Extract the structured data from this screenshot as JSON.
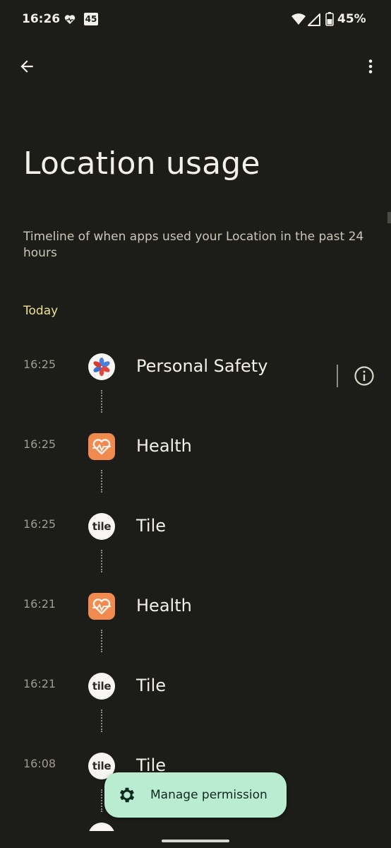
{
  "status_bar": {
    "time": "16:26",
    "badge": "45",
    "battery": "45%"
  },
  "header": {
    "title": "Location usage",
    "description": "Timeline of when apps used your Location in the past 24 hours"
  },
  "section": {
    "label": "Today"
  },
  "timeline": [
    {
      "time": "16:25",
      "app": "Personal Safety",
      "icon": "personal-safety-icon"
    },
    {
      "time": "16:25",
      "app": "Health",
      "icon": "health-icon"
    },
    {
      "time": "16:25",
      "app": "Tile",
      "icon": "tile-icon",
      "icon_text": "tile"
    },
    {
      "time": "16:21",
      "app": "Health",
      "icon": "health-icon"
    },
    {
      "time": "16:21",
      "app": "Tile",
      "icon": "tile-icon",
      "icon_text": "tile"
    },
    {
      "time": "16:08",
      "app": "Tile",
      "icon": "tile-icon",
      "icon_text": "tile"
    }
  ],
  "fab": {
    "label": "Manage permission"
  },
  "colors": {
    "background": "#1c1d19",
    "accent": "#e9e28f",
    "fab": "#b9ecd0",
    "health": "#f08a4e"
  }
}
